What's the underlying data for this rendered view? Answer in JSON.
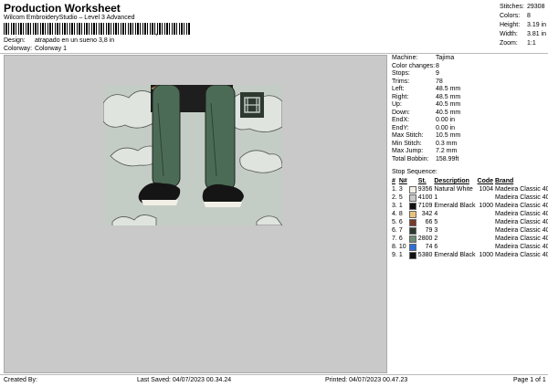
{
  "header": {
    "title": "Production Worksheet",
    "subtitle": "Wilcom EmbroideryStudio – Level 3 Advanced",
    "barcode_mark": ","
  },
  "design_info": {
    "design_label": "Design:",
    "design_value": "atrapado en un sueno 3,8 in",
    "colorway_label": "Colorway:",
    "colorway_value": "Colorway 1"
  },
  "stats": [
    {
      "label": "Stitches:",
      "value": "29308"
    },
    {
      "label": "Colors:",
      "value": "8"
    },
    {
      "label": "Height:",
      "value": "3.19 in"
    },
    {
      "label": "Width:",
      "value": "3.81 in"
    },
    {
      "label": "Zoom:",
      "value": "1:1"
    }
  ],
  "machine_info": [
    {
      "label": "Machine:",
      "value": "Tajima"
    },
    {
      "label": "Color changes:",
      "value": "8"
    },
    {
      "label": "Stops:",
      "value": "9"
    },
    {
      "label": "Trims:",
      "value": "78"
    },
    {
      "label": "Left:",
      "value": "48.5 mm"
    },
    {
      "label": "Right:",
      "value": "48.5 mm"
    },
    {
      "label": "Up:",
      "value": "40.5 mm"
    },
    {
      "label": "Down:",
      "value": "40.5 mm"
    },
    {
      "label": "EndX:",
      "value": "0.00 in"
    },
    {
      "label": "EndY:",
      "value": "0.00 in"
    },
    {
      "label": "Max Stitch:",
      "value": "10.5 mm"
    },
    {
      "label": "Min Stitch:",
      "value": "0.3 mm"
    },
    {
      "label": "Max Jump:",
      "value": "7.2 mm"
    },
    {
      "label": "Total Bobbin:",
      "value": "158.99ft"
    }
  ],
  "stop_sequence": {
    "title": "Stop Sequence:",
    "headers": [
      "#",
      "N#",
      "",
      "St.",
      "Description",
      "Code",
      "Brand"
    ],
    "rows": [
      {
        "num": "1.",
        "n": "3",
        "color": "#f2f0e6",
        "st": "9356",
        "desc": "Natural White",
        "code": "1004",
        "brand": "Madeira Classic 40"
      },
      {
        "num": "2.",
        "n": "5",
        "color": "#c8c8c8",
        "st": "4100",
        "desc": "1",
        "code": "",
        "brand": "Madeira Classic 40"
      },
      {
        "num": "3.",
        "n": "1",
        "color": "#111111",
        "st": "7109",
        "desc": "Emerald Black",
        "code": "1000",
        "brand": "Madeira Classic 40"
      },
      {
        "num": "4.",
        "n": "8",
        "color": "#e8c27a",
        "st": "342",
        "desc": "4",
        "code": "",
        "brand": "Madeira Classic 40"
      },
      {
        "num": "5.",
        "n": "6",
        "color": "#7a3a2a",
        "st": "66",
        "desc": "5",
        "code": "",
        "brand": "Madeira Classic 40"
      },
      {
        "num": "6.",
        "n": "7",
        "color": "#2e3a30",
        "st": "79",
        "desc": "3",
        "code": "",
        "brand": "Madeira Classic 40"
      },
      {
        "num": "7.",
        "n": "6",
        "color": "#6e8c78",
        "st": "2800",
        "desc": "2",
        "code": "",
        "brand": "Madeira Classic 40"
      },
      {
        "num": "8.",
        "n": "10",
        "color": "#2d6fd6",
        "st": "74",
        "desc": "6",
        "code": "",
        "brand": "Madeira Classic 40"
      },
      {
        "num": "9.",
        "n": "1",
        "color": "#111111",
        "st": "5380",
        "desc": "Emerald Black",
        "code": "1000",
        "brand": "Madeira Classic 40"
      }
    ]
  },
  "footer": {
    "created_by": "Created By:",
    "last_saved": "Last Saved: 04/07/2023 00.34.24",
    "printed": "Printed: 04/07/2023 00.47.23",
    "page": "Page 1 of 1"
  },
  "colors": {
    "canvas": "#c9c9c9",
    "design_bg": "#c4cdc5"
  }
}
